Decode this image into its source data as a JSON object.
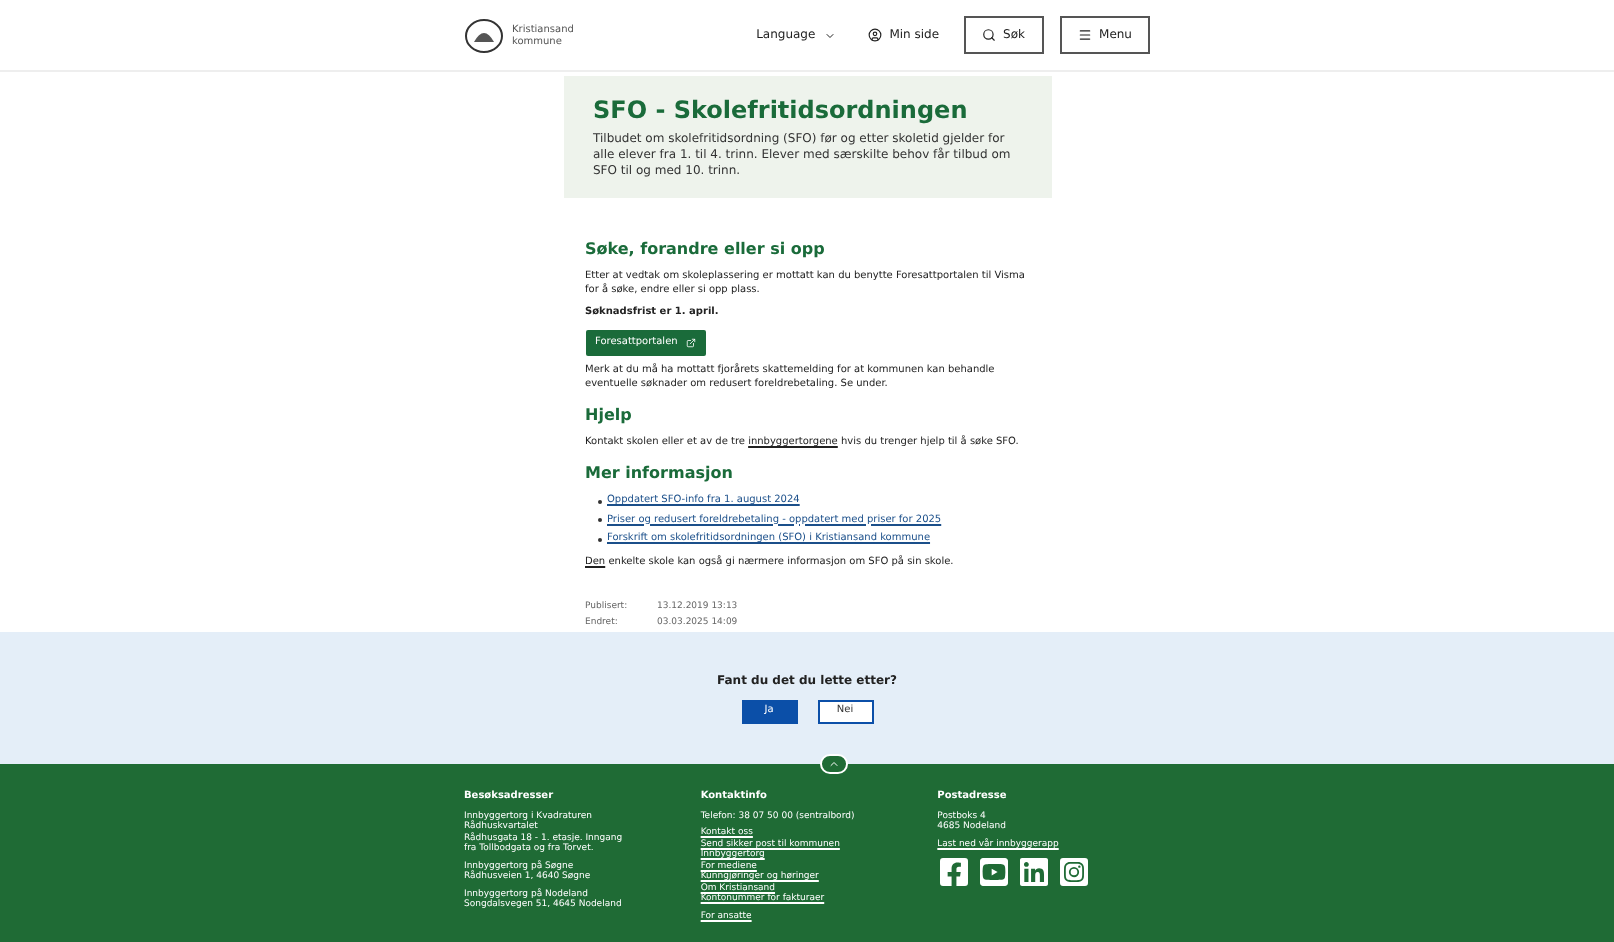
{
  "header": {
    "logo_text": [
      "Kristiansand",
      "kommune"
    ],
    "nav": [
      {
        "kind": "language",
        "label": "Language"
      },
      {
        "kind": "user",
        "label": "Min side"
      },
      {
        "kind": "search",
        "label": "Søk"
      },
      {
        "kind": "menu",
        "label": "Menu"
      }
    ]
  },
  "hero": {
    "title": "SFO - Skolefritidsordningen",
    "intro": "Tilbudet om skolefritidsordning (SFO) før og etter skoletid gjelder for alle elever fra 1. til 4. trinn. Elever med særskilte behov får tilbud om SFO til og med 10. trinn."
  },
  "sections": [
    {
      "heading": "Søke, forandre eller si opp",
      "blocks": [
        {
          "kind": "text",
          "text": "Etter at vedtak om skoleplassering er mottatt kan du benytte Foresattportalen til Visma for å søke, endre eller si opp plass."
        },
        {
          "kind": "bold",
          "text": "Søknadsfrist er 1. april."
        },
        {
          "kind": "button",
          "text": "Foresattportalen"
        },
        {
          "kind": "text",
          "text": "Merk at du må ha mottatt fjorårets skattemelding for at kommunen kan behandle eventuelle søknader om redusert foreldrebetaling. Se under."
        }
      ]
    },
    {
      "heading": "Hjelp",
      "blocks": [
        {
          "kind": "linktext",
          "before": "Kontakt skolen eller et av de tre ",
          "link": "innbyggertorgene",
          "after": " hvis du trenger hjelp til å søke SFO."
        }
      ]
    },
    {
      "heading": "Mer informasjon",
      "blocks": [
        {
          "kind": "list",
          "items": [
            "Oppdatert SFO-info fra 1. august 2024",
            "Priser og redusert foreldrebetaling - oppdatert med priser for 2025",
            "Forskrift om skolefritidsordningen (SFO) i Kristiansand kommune"
          ]
        },
        {
          "kind": "linktext",
          "link": "Den",
          "after": " enkelte skole kan også gi nærmere informasjon om SFO på sin skole."
        }
      ]
    }
  ],
  "meta": [
    {
      "label": "Publisert:",
      "value": "13.12.2019 13:13"
    },
    {
      "label": "Endret:",
      "value": "03.03.2025 14:09"
    }
  ],
  "feedback": {
    "question": "Fant du det du lette etter?",
    "buttons": [
      {
        "label": "Ja",
        "primary": true
      },
      {
        "label": "Nei",
        "primary": false
      }
    ]
  },
  "footer": {
    "columns": [
      {
        "title": "Besøksadresser",
        "groups": [
          {
            "kind": "text",
            "lines": [
              "Innbyggertorg i Kvadraturen",
              "Rådhuskvartalet",
              "Rådhusgata 18 - 1. etasje. Inngang",
              "fra Tollbodgata og fra Torvet."
            ]
          },
          {
            "kind": "text",
            "lines": [
              "Innbyggertorg på Søgne",
              "Rådhusveien 1, 4640 Søgne"
            ]
          },
          {
            "kind": "text",
            "lines": [
              "Innbyggertorg på Nodeland",
              "Songdalsvegen 51, 4645 Nodeland"
            ]
          }
        ]
      },
      {
        "title": "Kontaktinfo",
        "groups": [
          {
            "kind": "text",
            "lines": [
              "Telefon: 38 07 50 00 (sentralbord)"
            ]
          },
          {
            "kind": "links",
            "lines": [
              "Kontakt oss",
              "Send sikker post til kommunen",
              "Innbyggertorg",
              "For mediene",
              "Kunngjøringer og høringer",
              "Om Kristiansand",
              "Kontonummer for fakturaer"
            ]
          },
          {
            "kind": "links",
            "lines": [
              "For ansatte"
            ]
          }
        ]
      },
      {
        "title": "Postadresse",
        "groups": [
          {
            "kind": "text",
            "lines": [
              "Postboks 4",
              "4685 Nodeland"
            ]
          },
          {
            "kind": "links",
            "lines": [
              "Last ned vår innbyggerapp"
            ]
          },
          {
            "kind": "social",
            "icons": [
              {
                "kind": "facebook"
              },
              {
                "kind": "youtube"
              },
              {
                "kind": "linkedin"
              },
              {
                "kind": "instagram"
              }
            ]
          }
        ]
      }
    ]
  }
}
